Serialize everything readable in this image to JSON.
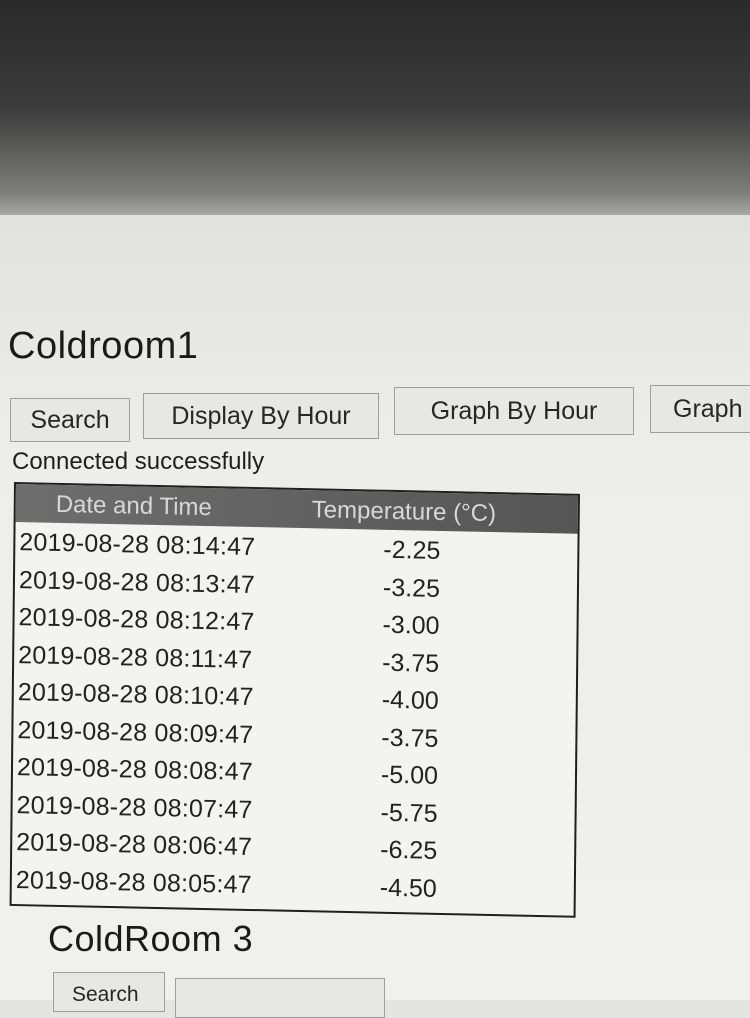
{
  "sections": [
    {
      "title": "Coldroom1",
      "buttons": {
        "search": "Search",
        "display_by_hour": "Display By Hour",
        "graph_by_hour": "Graph By Hour",
        "graph_cut": "Graph"
      },
      "status": "Connected successfully",
      "table": {
        "headers": [
          "Date and Time",
          "Temperature (°C)"
        ],
        "rows": [
          {
            "datetime": "2019-08-28 08:14:47",
            "temperature": "-2.25"
          },
          {
            "datetime": "2019-08-28 08:13:47",
            "temperature": "-3.25"
          },
          {
            "datetime": "2019-08-28 08:12:47",
            "temperature": "-3.00"
          },
          {
            "datetime": "2019-08-28 08:11:47",
            "temperature": "-3.75"
          },
          {
            "datetime": "2019-08-28 08:10:47",
            "temperature": "-4.00"
          },
          {
            "datetime": "2019-08-28 08:09:47",
            "temperature": "-3.75"
          },
          {
            "datetime": "2019-08-28 08:08:47",
            "temperature": "-5.00"
          },
          {
            "datetime": "2019-08-28 08:07:47",
            "temperature": "-5.75"
          },
          {
            "datetime": "2019-08-28 08:06:47",
            "temperature": "-6.25"
          },
          {
            "datetime": "2019-08-28 08:05:47",
            "temperature": "-4.50"
          }
        ]
      }
    },
    {
      "title": "ColdRoom 3",
      "buttons": {
        "search": "Search",
        "display_by_hour": ""
      }
    }
  ],
  "colors": {
    "header_bg": "#606060",
    "header_text": "#d8d8d8",
    "button_bg": "#e7e7e5",
    "page_bg": "#efefed"
  }
}
